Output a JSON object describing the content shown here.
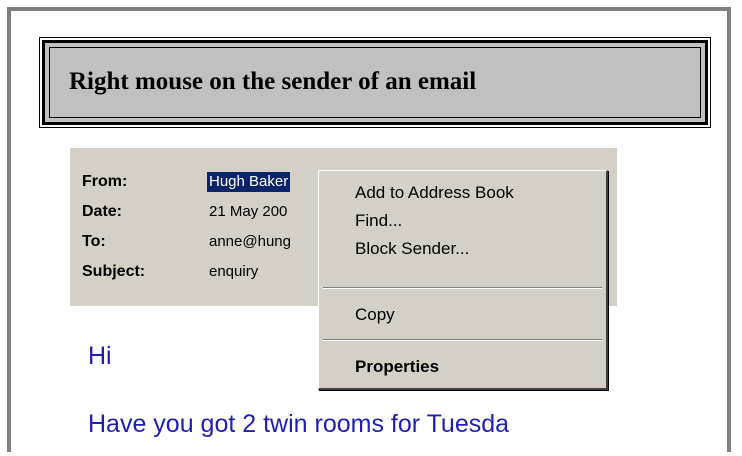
{
  "title": "Right mouse on the sender of an email",
  "headers": [
    {
      "label": "From:",
      "value": "Hugh Baker"
    },
    {
      "label": "Date:",
      "value": "21 May 200"
    },
    {
      "label": "To:",
      "value": "anne@hung"
    },
    {
      "label": "Subject:",
      "value": "enquiry"
    }
  ],
  "context_menu": {
    "add_to_address_book": "Add to Address Book",
    "find": "Find...",
    "block_sender": "Block Sender...",
    "copy": "Copy",
    "properties": "Properties"
  },
  "body": {
    "greeting": "Hi",
    "line1": "Have you got 2 twin rooms for  Tuesda"
  },
  "colors": {
    "selection": "#0a246a",
    "body_text": "#1e1eb4",
    "menu_bg": "#d4d0c8",
    "title_bg": "#c0c0c0"
  }
}
